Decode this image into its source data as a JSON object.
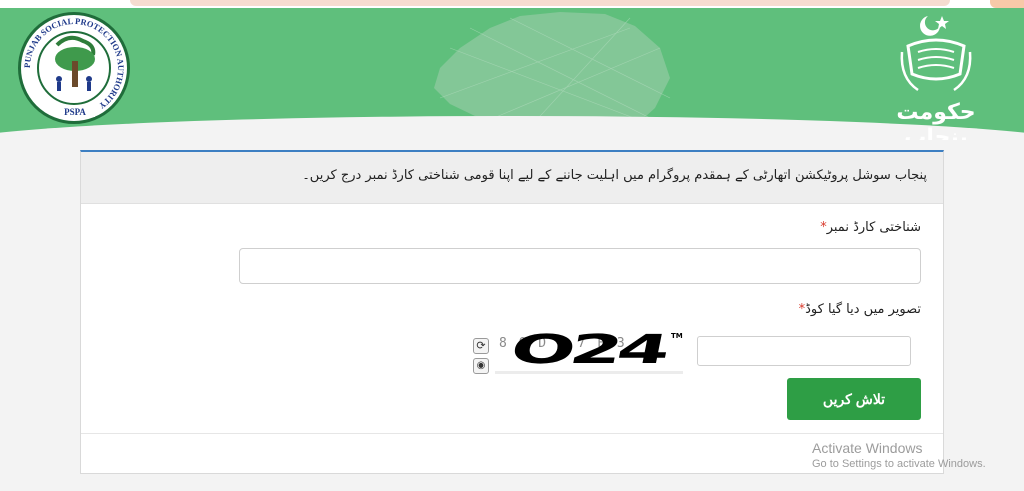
{
  "header": {
    "left_logo": {
      "ring_text": "PUNJAB SOCIAL PROTECTION AUTHORITY",
      "abbreviation": "PSPA"
    },
    "right_logo": {
      "title": "حکومت پنجاب"
    },
    "colors": {
      "banner": "#5fbf7c",
      "accent": "#3d7fc2"
    }
  },
  "form": {
    "instruction": "پنجاب سوشل پروٹیکشن اتھارٹی کے ہمقدم پروگرام میں اہلیت جاننے کے لیے اپنا قومی شناختی کارڈ نمبر درج کریں۔",
    "cnic_label": "شناختی کارڈ نمبر",
    "cnic_value": "",
    "captcha_label": "تصویر میں دیا گیا کوڈ",
    "required_mark": "*",
    "captcha_faint_text": "8 0 D B 7 E 3",
    "captcha_text": "O24",
    "captcha_tm": "TM",
    "captcha_value": "",
    "refresh_icon": "refresh-icon",
    "audio_icon": "audio-icon",
    "search_button": "تلاش کریں",
    "button_color": "#2e9e45"
  },
  "watermark": {
    "line1": "Activate Windows",
    "line2": "Go to Settings to activate Windows."
  }
}
